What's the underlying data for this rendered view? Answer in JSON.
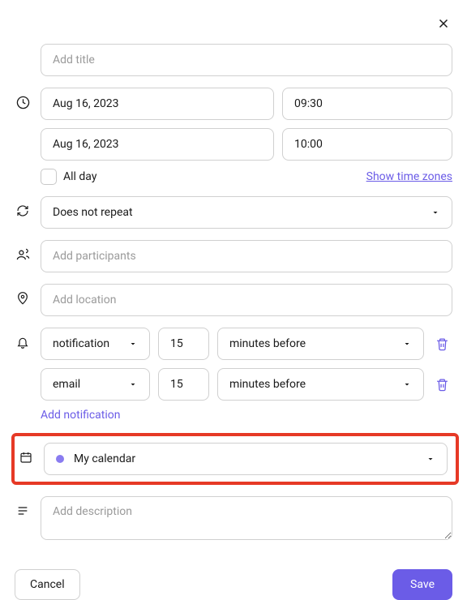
{
  "title": {
    "placeholder": "Add title"
  },
  "dates": {
    "start_date": "Aug 16, 2023",
    "start_time": "09:30",
    "end_date": "Aug 16, 2023",
    "end_time": "10:00",
    "all_day_label": "All day",
    "timezone_link": "Show time zones"
  },
  "repeat": {
    "value": "Does not repeat"
  },
  "participants": {
    "placeholder": "Add participants"
  },
  "location": {
    "placeholder": "Add location"
  },
  "notifications": [
    {
      "type": "notification",
      "amount": "15",
      "unit": "minutes before"
    },
    {
      "type": "email",
      "amount": "15",
      "unit": "minutes before"
    }
  ],
  "add_notification_label": "Add notification",
  "calendar": {
    "name": "My calendar",
    "color": "#8a7cf0"
  },
  "description": {
    "placeholder": "Add description"
  },
  "footer": {
    "cancel": "Cancel",
    "save": "Save"
  }
}
